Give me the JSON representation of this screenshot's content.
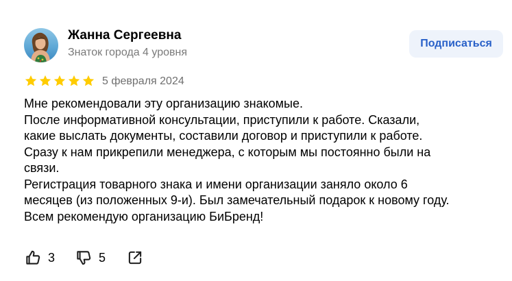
{
  "author": {
    "name": "Жанна Сергеевна",
    "level": "Знаток города 4 уровня",
    "avatar_icon": "user-photo"
  },
  "subscribe_button": {
    "label": "Подписаться",
    "color": "#2860c8",
    "background": "#eef3fb"
  },
  "rating": {
    "stars": 5,
    "max": 5,
    "color": "#ffcc00"
  },
  "review": {
    "date": "5 февраля 2024",
    "lines": [
      "Мне рекомендовали эту организацию знакомые.",
      "После информативной консультации, приступили к работе. Сказали,",
      "какие выслать документы, составили договор и приступили к работе.",
      "Сразу к нам прикрепили менеджера, с которым мы постоянно были на",
      "связи.",
      "Регистрация товарного знака и имени организации заняло около 6",
      "месяцев (из положенных 9-и). Был замечательный подарок к новому году.",
      "Всем рекомендую организацию БиБренд!"
    ]
  },
  "actions": {
    "likes": "3",
    "dislikes": "5",
    "like_icon": "thumbs-up-icon",
    "dislike_icon": "thumbs-down-icon",
    "share_icon": "share-icon"
  }
}
